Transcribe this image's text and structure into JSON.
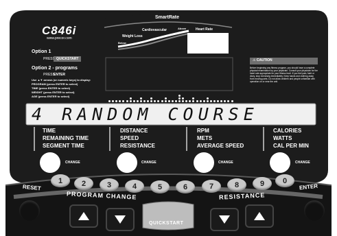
{
  "brand": {
    "model": "C846i",
    "url": "www.precor.com"
  },
  "smartrate": {
    "title": "SmartRate",
    "labels": {
      "fatloss": "Weight Loss",
      "below": "Below",
      "cardio": "Cardiovascular",
      "above": "Above",
      "heart": "Heart Rate"
    }
  },
  "options": {
    "option1_title": "Option 1",
    "press_word": "PRESS",
    "quickstart_badge": "QUICKSTART",
    "option2_title": "Option 2 - programs",
    "press_enter_word": "PRESS",
    "enter_word": "ENTER",
    "instruction": "Use ▲▼ arrows (or numeric keys) to display:",
    "lines": [
      "PROGRAM (press ENTER to select)",
      "TIME (press ENTER to select)",
      "WEIGHT (press ENTER to select)",
      "AGE (press ENTER to select)"
    ]
  },
  "caution": {
    "title": "⚠ CAUTION",
    "body": "Before beginning any fitness program, you should have a complete physical examination by your physician. Consult your physician for the heart rate appropriate for your fitness level. If you feel pain, faint or dizzy, stop exercising immediately. Keep hands and clothing away from moving parts. Do not allow children and people unfamiliar with operation on or near the unit."
  },
  "display": {
    "message": "4 RANDOM COURSE"
  },
  "groups": [
    {
      "items": [
        "TIME",
        "REMAINING TIME",
        "SEGMENT TIME"
      ],
      "change": "CHANGE"
    },
    {
      "items": [
        "DISTANCE",
        "SPEED",
        "RESISTANCE"
      ],
      "change": "CHANGE"
    },
    {
      "items": [
        "RPM",
        "METS",
        "AVERAGE SPEED"
      ],
      "change": "CHANGE"
    },
    {
      "items": [
        "CALORIES",
        "WATTS",
        "CAL PER MIN"
      ],
      "change": "CHANGE"
    }
  ],
  "keypad": {
    "numbers": [
      "1",
      "2",
      "3",
      "4",
      "5",
      "6",
      "7",
      "8",
      "9",
      "0"
    ]
  },
  "labels": {
    "reset": "RESET",
    "program_change": "PROGRAM CHANGE",
    "resistance": "RESISTANCE",
    "enter": "ENTER",
    "quickstart": "QUICKSTART"
  },
  "colors": {
    "panel": "#1c1c1c",
    "badge": "#6e6e6e",
    "display": "#f0f0f0"
  }
}
